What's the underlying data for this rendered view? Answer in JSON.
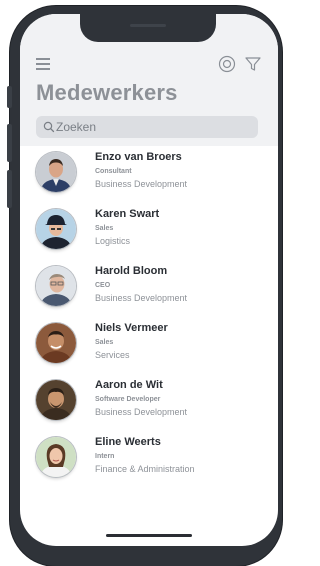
{
  "header": {
    "title": "Medewerkers",
    "menu_icon": "hamburger-menu-icon",
    "settings_icon": "settings-circle-icon",
    "filter_icon": "filter-funnel-icon"
  },
  "search": {
    "placeholder": "Zoeken",
    "icon": "search-icon"
  },
  "employees": [
    {
      "name": "Enzo van Broers",
      "role": "Consultant",
      "department": "Business Development"
    },
    {
      "name": "Karen Swart",
      "role": "Sales",
      "department": "Logistics"
    },
    {
      "name": "Harold Bloom",
      "role": "CEO",
      "department": "Business Development"
    },
    {
      "name": "Niels Vermeer",
      "role": "Sales",
      "department": "Services"
    },
    {
      "name": "Aaron de Wit",
      "role": "Software Developer",
      "department": "Business Development"
    },
    {
      "name": "Eline Weerts",
      "role": "Intern",
      "department": "Finance & Administration"
    }
  ],
  "colors": {
    "header_bg": "#f1f2f4",
    "title": "#8d9197",
    "search_bg": "#dcdee2",
    "name_text": "#2b2f35",
    "meta_text": "#8e9298",
    "device_frame": "#2f3339"
  }
}
